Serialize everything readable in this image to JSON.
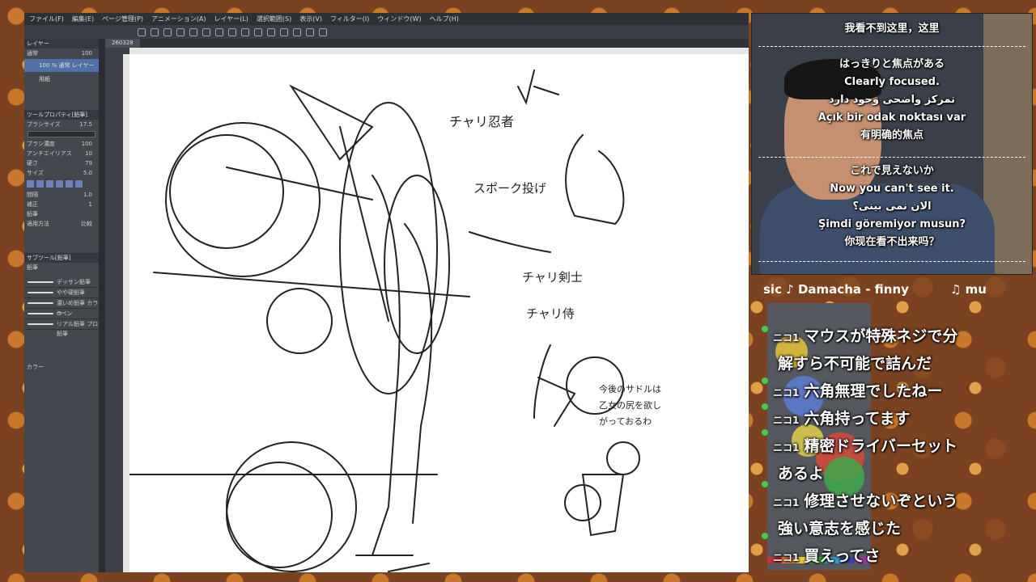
{
  "app": {
    "menu": [
      "ファイル(F)",
      "編集(E)",
      "ページ管理(P)",
      "アニメーション(A)",
      "レイヤー(L)",
      "選択範囲(S)",
      "表示(V)",
      "フィルター(I)",
      "ウィンドウ(W)",
      "ヘルプ(H)"
    ],
    "tab_label": "260328",
    "left_panel": {
      "layer_header": "レイヤー",
      "blend_mode": "通常",
      "opacity": "100",
      "layer1": "100 % 通常 レイヤー",
      "layer2": "用紙",
      "tool_prop_header": "ツールプロパティ[鉛筆]",
      "brush_size_label": "ブラシサイズ",
      "brush_size": "17.5",
      "brush_density_label": "ブラシ濃度",
      "brush_density": "100",
      "anti_alias_label": "アンチエイリアス",
      "anti_alias": "10",
      "hardness_label": "硬さ",
      "hardness": "79",
      "size_label": "サイズ",
      "size_val": "5.0",
      "spacing_label": "間隔",
      "spacing_val": "1.0",
      "stabilization_label": "補正",
      "stabilization_val": "1",
      "mode_label": "適用方法",
      "mode_val": "比較",
      "pencil_btn": "鉛筆",
      "sub_tool_header": "サブツール[鉛筆]",
      "sub_tab_pencil": "鉛筆",
      "brushes": [
        "デッサン鉛筆",
        "やや硬鉛筆",
        "濃いめ鉛筆 カラー",
        "Gペン",
        "リアル鉛筆 プロ鉛筆"
      ],
      "color_label": "カラー"
    }
  },
  "webcam": {
    "lines_top": [
      "我看不到这里，这里"
    ],
    "block1": [
      "はっきりと焦点がある",
      "Clearly focused.",
      "تمرکز واضحی وجود دارد",
      "Açık bir odak noktası var",
      "有明确的焦点"
    ],
    "block2": [
      "これで見えないか",
      "Now you can't see it.",
      "الان نمی بینی؟",
      "Şimdi göremiyor musun?",
      "你现在看不出来吗？"
    ]
  },
  "music": {
    "ticker_a": "sic ♪ Damacha - finny",
    "ticker_b": "♫ mu"
  },
  "comments": [
    {
      "badge": "ニコ1",
      "text": "マウスが特殊ネジで分"
    },
    {
      "badge": "",
      "text": "解すら不可能で詰んだ"
    },
    {
      "badge": "ニコ1",
      "text": "六角無理でしたねー"
    },
    {
      "badge": "ニコ1",
      "text": "六角持ってます"
    },
    {
      "badge": "ニコ1",
      "text": "精密ドライバーセット"
    },
    {
      "badge": "",
      "text": "あるよ"
    },
    {
      "badge": "ニコ1",
      "text": "修理させないぞという"
    },
    {
      "badge": "",
      "text": "強い意志を感じた"
    },
    {
      "badge": "ニコ1",
      "text": "買えってさ"
    }
  ],
  "sketch_notes": [
    "チャリ剣士",
    "チャリ侍",
    "チャリ忍者",
    "スポーク投げ",
    "今後のサドルは",
    "乙女の尻を欲し",
    "がっておるわ"
  ]
}
